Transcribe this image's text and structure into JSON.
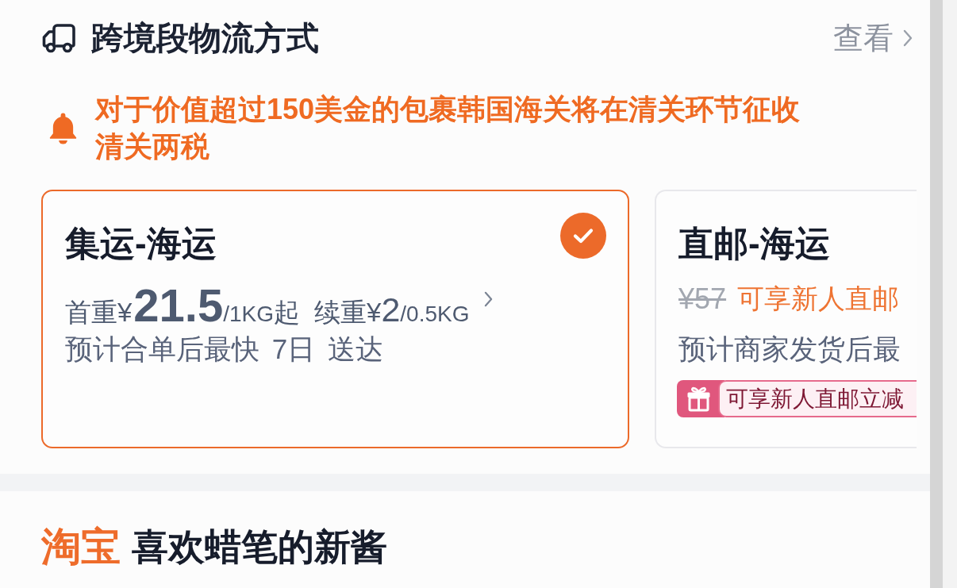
{
  "section": {
    "title": "跨境段物流方式",
    "link": "查看"
  },
  "notice": "对于价值超过150美金的包裹韩国海关将在清关环节征收清关两税",
  "options": [
    {
      "kind": "priced",
      "title": "集运-海运",
      "selected": true,
      "first_weight": {
        "label": "首重",
        "currency": "¥",
        "amount": "21.5",
        "unit": "/1KG",
        "suffix": "起"
      },
      "additional_weight": {
        "label": "续重",
        "currency": "¥",
        "amount": "2",
        "unit": "/0.5KG"
      },
      "delivery": "预计合单后最快 7日 送达"
    },
    {
      "kind": "promo",
      "title": "直邮-海运",
      "selected": false,
      "original_price": "¥57",
      "promo_text": "可享新人直邮",
      "delivery": "预计商家发货后最",
      "badge": "可享新人直邮立减"
    }
  ],
  "shop": {
    "logo": "淘宝",
    "name": "喜欢蜡笔的新酱"
  }
}
